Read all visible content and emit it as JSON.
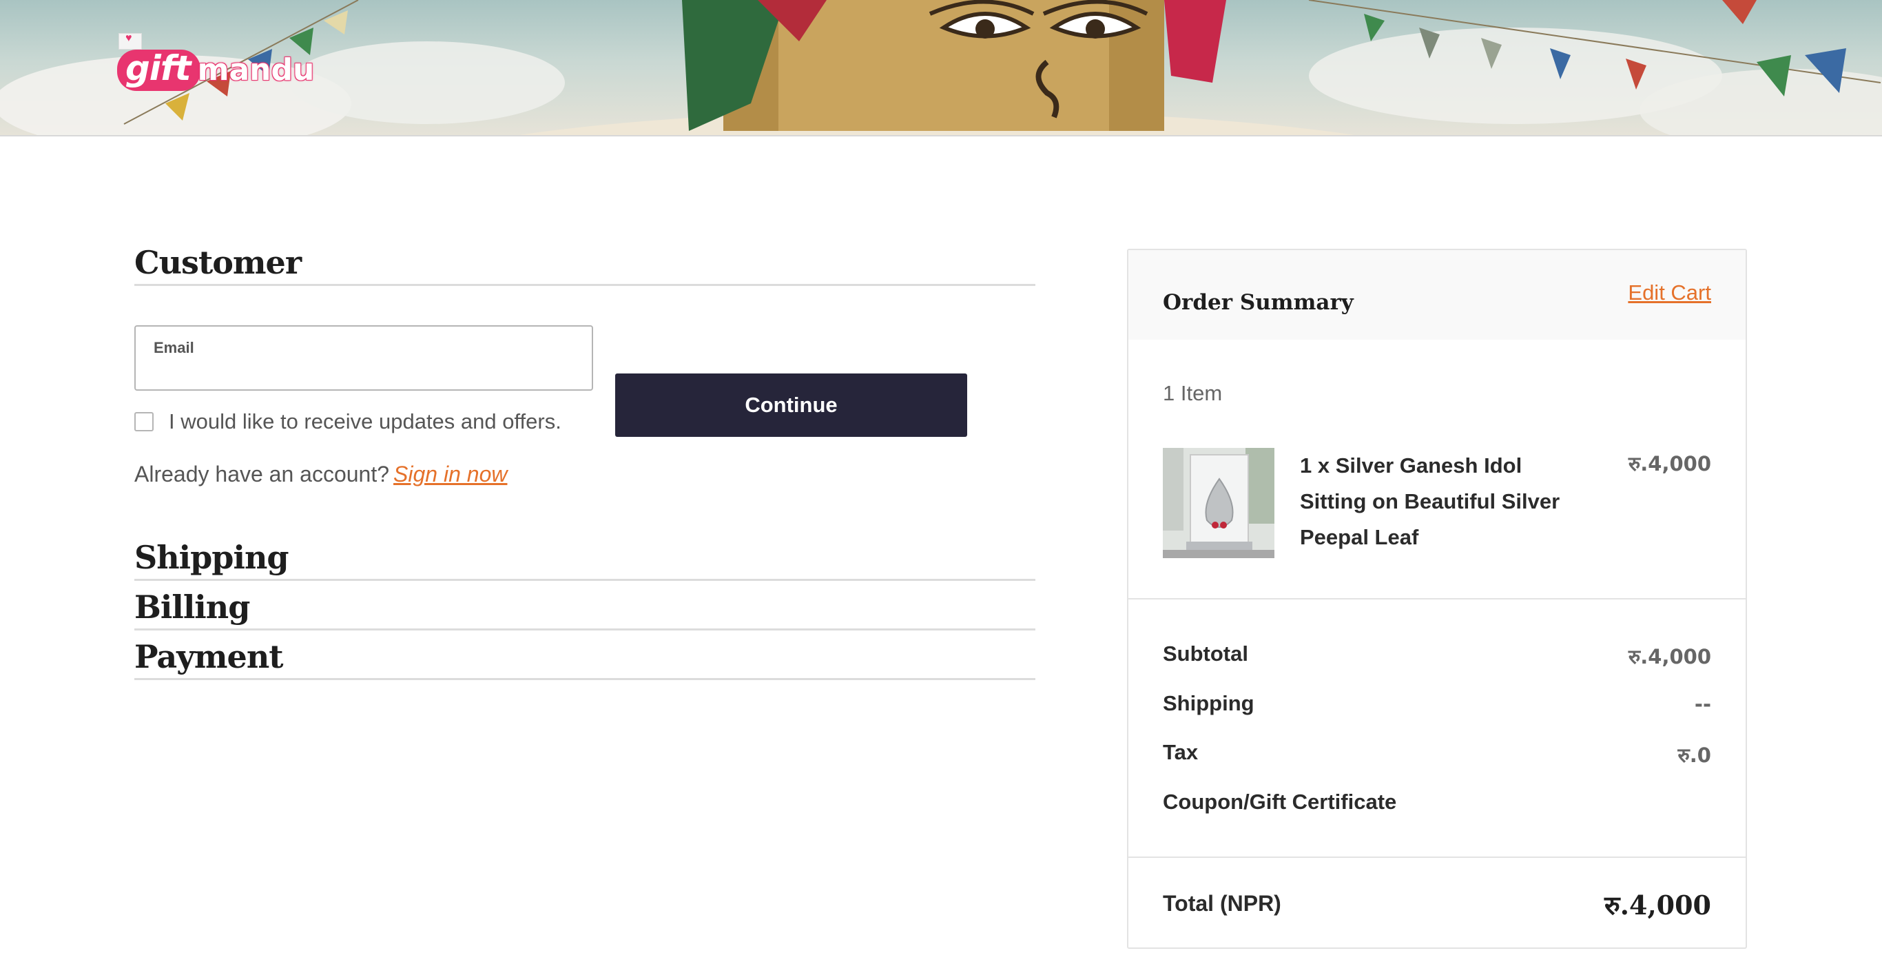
{
  "header": {
    "logo_gift": "gift",
    "logo_mandu": "mandu"
  },
  "customer": {
    "title": "Customer",
    "email_label": "Email",
    "email_value": "",
    "email_placeholder": "",
    "optin_label": "I would like to receive updates and offers.",
    "optin_checked": false,
    "continue_label": "Continue",
    "account_prompt": "Already have an account?",
    "signin_label": "Sign in now"
  },
  "steps": {
    "shipping": "Shipping",
    "billing": "Billing",
    "payment": "Payment"
  },
  "summary": {
    "title": "Order Summary",
    "edit_cart": "Edit Cart",
    "item_count": "1 Item",
    "item": {
      "name": "1 x Silver Ganesh Idol Sitting on Beautiful Silver Peepal Leaf",
      "price": "रु.4,000"
    },
    "rows": [
      {
        "label": "Subtotal",
        "value": "रु.4,000"
      },
      {
        "label": "Shipping",
        "value": "--"
      },
      {
        "label": "Tax",
        "value": "रु.0"
      },
      {
        "label": "Coupon/Gift Certificate",
        "value": ""
      }
    ],
    "total_label": "Total (NPR)",
    "total_value": "रु.4,000"
  },
  "colors": {
    "accent": "#e5712a",
    "button": "#26253a",
    "brand_pink": "#e8356f"
  }
}
